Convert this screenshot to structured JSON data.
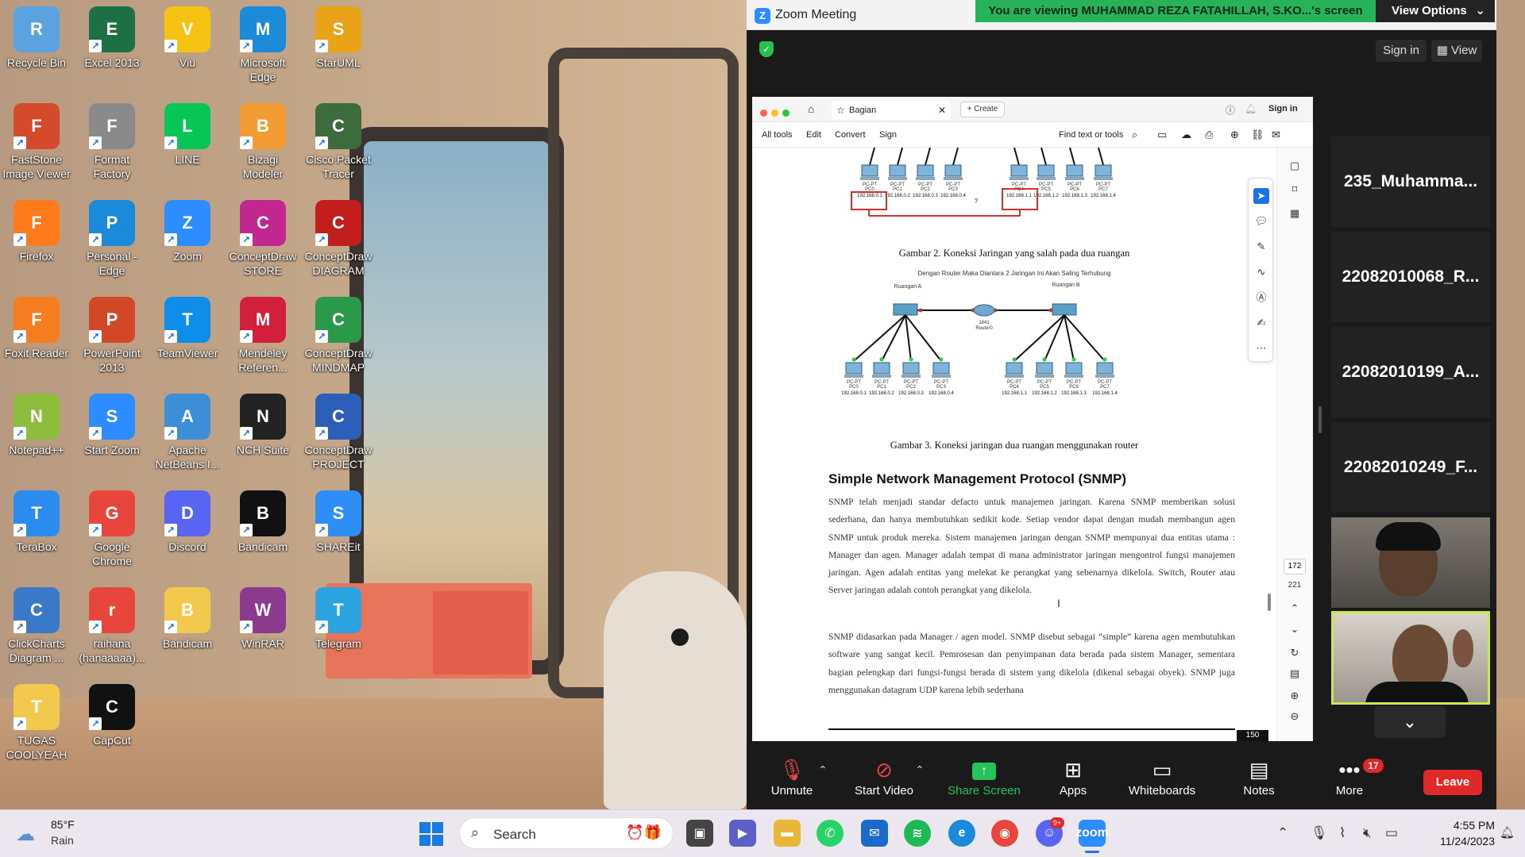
{
  "desktop": {
    "icons": [
      {
        "label": "Recycle Bin",
        "icon": "recycle-bin-icon",
        "color": "#5ba3e0"
      },
      {
        "label": "Excel 2013",
        "icon": "excel-icon",
        "color": "#1d7044"
      },
      {
        "label": "Viu",
        "icon": "viu-icon",
        "color": "#f5c211"
      },
      {
        "label": "Microsoft Edge",
        "icon": "edge-icon",
        "color": "#1b8ad8"
      },
      {
        "label": "StarUML",
        "icon": "staruml-icon",
        "color": "#e8a317"
      },
      {
        "label": "FastStone Image Viewer",
        "icon": "faststone-icon",
        "color": "#d44a2a"
      },
      {
        "label": "Format Factory",
        "icon": "format-factory-icon",
        "color": "#8a8a8a"
      },
      {
        "label": "LINE",
        "icon": "line-icon",
        "color": "#06c755"
      },
      {
        "label": "Bizagi Modeler",
        "icon": "bizagi-icon",
        "color": "#f39c33"
      },
      {
        "label": "Cisco Packet Tracer",
        "icon": "cisco-packet-tracer-icon",
        "color": "#3c6b3c"
      },
      {
        "label": "Firefox",
        "icon": "firefox-icon",
        "color": "#ff7a1a"
      },
      {
        "label": "Personal - Edge",
        "icon": "edge-personal-icon",
        "color": "#1b8ad8"
      },
      {
        "label": "Zoom",
        "icon": "zoom-icon",
        "color": "#2d8cff"
      },
      {
        "label": "ConceptDraw STORE",
        "icon": "conceptdraw-store-icon",
        "color": "#c2268f"
      },
      {
        "label": "ConceptDraw DIAGRAM",
        "icon": "conceptdraw-diagram-icon",
        "color": "#c41d1d"
      },
      {
        "label": "Foxit Reader",
        "icon": "foxit-icon",
        "color": "#f57c1f"
      },
      {
        "label": "PowerPoint 2013",
        "icon": "powerpoint-icon",
        "color": "#d24726"
      },
      {
        "label": "TeamViewer",
        "icon": "teamviewer-icon",
        "color": "#0e8ee9"
      },
      {
        "label": "Mendeley Referen...",
        "icon": "mendeley-icon",
        "color": "#d21f3c"
      },
      {
        "label": "ConceptDraw MINDMAP",
        "icon": "conceptdraw-mindmap-icon",
        "color": "#2a9a4a"
      },
      {
        "label": "Notepad++",
        "icon": "notepadpp-icon",
        "color": "#8dbd3c"
      },
      {
        "label": "Start Zoom",
        "icon": "start-zoom-icon",
        "color": "#2d8cff"
      },
      {
        "label": "Apache NetBeans I...",
        "icon": "netbeans-icon",
        "color": "#3c8ed6"
      },
      {
        "label": "NCH Suite",
        "icon": "nch-suite-icon",
        "color": "#222222"
      },
      {
        "label": "ConceptDraw PROJECT",
        "icon": "conceptdraw-project-icon",
        "color": "#2b5fb8"
      },
      {
        "label": "TeraBox",
        "icon": "terabox-icon",
        "color": "#2b8cf0"
      },
      {
        "label": "Google Chrome",
        "icon": "chrome-icon",
        "color": "#e8453c"
      },
      {
        "label": "Discord",
        "icon": "discord-icon",
        "color": "#5865f2"
      },
      {
        "label": "Bandicam",
        "icon": "bandicam-icon",
        "color": "#111111"
      },
      {
        "label": "SHAREit",
        "icon": "shareit-icon",
        "color": "#2f8ef5"
      },
      {
        "label": "ClickCharts Diagram ...",
        "icon": "clickcharts-icon",
        "color": "#3a78c8"
      },
      {
        "label": "raihana (hanaaaaa)...",
        "icon": "chrome-profile-icon",
        "color": "#e8453c"
      },
      {
        "label": "Bandicam",
        "icon": "folder-icon",
        "color": "#f2c94c"
      },
      {
        "label": "WinRAR",
        "icon": "winrar-icon",
        "color": "#8b3a8e"
      },
      {
        "label": "Telegram",
        "icon": "telegram-icon",
        "color": "#2aa3e0"
      },
      {
        "label": "TUGAS COOLYEAH",
        "icon": "folder-icon",
        "color": "#f2c94c"
      },
      {
        "label": "CapCut",
        "icon": "capcut-icon",
        "color": "#111111"
      }
    ]
  },
  "zoom": {
    "title": "Zoom Meeting",
    "banner": "You are viewing MUHAMMAD REZA FATAHILLAH, S.KO...'s screen",
    "view_options": "View Options",
    "sign_in": "Sign in",
    "view": "View",
    "participants": [
      "235_Muhamma...",
      "22082010068_R...",
      "22082010199_A...",
      "22082010249_F..."
    ],
    "controls": {
      "unmute": "Unmute",
      "start_video": "Start Video",
      "share_screen": "Share Screen",
      "apps": "Apps",
      "whiteboards": "Whiteboards",
      "notes": "Notes",
      "more": "More",
      "more_badge": "17",
      "leave": "Leave"
    },
    "share_color": "#26c25a"
  },
  "pdf": {
    "tab": "Bagian",
    "create": "Create",
    "sign_in": "Sign in",
    "toolbar": {
      "all_tools": "All tools",
      "edit": "Edit",
      "convert": "Convert",
      "sign": "Sign",
      "find": "Find text or tools"
    },
    "page_num": "172",
    "page_total": "221",
    "footer_page": "150",
    "diagram_top": {
      "pcs_left": [
        "PC-PT PC0",
        "PC-PT PC1",
        "PC-PT PC2",
        "PC-PT PC3"
      ],
      "pcs_right": [
        "PC-PT PC4",
        "PC-PT PC5",
        "PC-PT PC6",
        "PC-PT PC7"
      ],
      "ips_left": [
        "192.168.0.1",
        "192.168.0.2",
        "192.168.0.3",
        "192.168.0.4"
      ],
      "ips_right": [
        "192.168.1.1",
        "192.168.1.2",
        "192.168.1.3",
        "192.168.1.4"
      ],
      "question": "?"
    },
    "caption2": "Gambar 2. Koneksi Jaringan yang salah pada dua ruangan",
    "subcaption3": "Dengan Router Maka Diantara 2 Jaringan Ini Akan Saling Terhubung",
    "room_a": "Ruangan A",
    "room_b": "Ruangan B",
    "router_model": "1841",
    "router_name": "Router0",
    "caption3": "Gambar 3. Koneksi jaringan dua ruangan menggunakan router",
    "section_title": "Simple Network Management Protocol (SNMP)",
    "para1": "SNMP telah menjadi standar defacto untuk manajemen jaringan. Karena SNMP memberikan solusi sederhana, dan hanya membutuhkan sedikit kode. Setiap vendor dapat dengan mudah membangun agen SNMP untuk produk mereka. Sistem manajemen jaringan dengan SNMP mempunyai dua entitas utama : Manager dan agen. Manager adalah tempat di mana administrator jaringan mengontrol fungsi manajemen jaringan. Agen adalah entitas yang melekat ke perangkat yang sebenarnya dikelola. Switch, Router atau Server jaringan adalah contoh perangkat yang dikelola.",
    "para2": "SNMP didasarkan pada Manager / agen model. SNMP disebut sebagai “simple” karena agen membutuhkan software yang sangat kecil. Pemrosesan dan penyimpanan data berada pada sistem Manager, sementara bagian pelengkap dari fungsi-fungsi berada di sistem yang dikelola (dikenal sebagai obyek). SNMP juga menggunakan datagram UDP karena lebih sederhana"
  },
  "taskbar": {
    "temp": "85°F",
    "weather": "Rain",
    "search": "Search",
    "time": "4:55 PM",
    "date": "11/24/2023",
    "discord_badge": "9+"
  }
}
